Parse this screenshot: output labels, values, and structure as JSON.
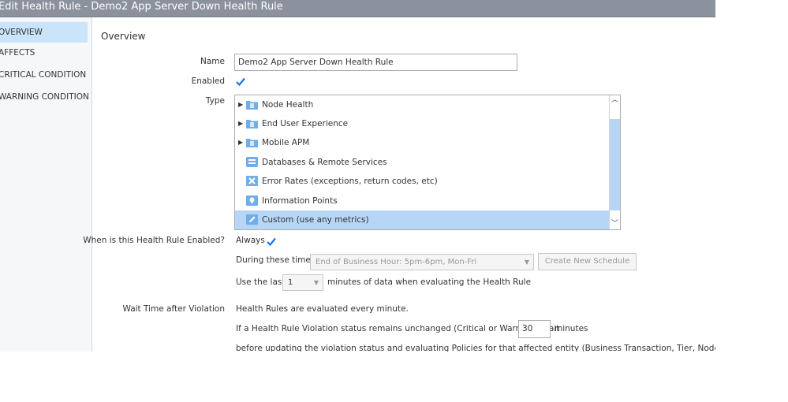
{
  "window": {
    "title": "Edit Health Rule - Demo2 App Server Down Health Rule"
  },
  "sidebar": {
    "items": [
      {
        "label": "OVERVIEW",
        "active": true
      },
      {
        "label": "AFFECTS",
        "active": false
      },
      {
        "label": "CRITICAL CONDITION",
        "active": false
      },
      {
        "label": "WARNING CONDITION",
        "active": false
      }
    ]
  },
  "overview": {
    "heading": "Overview",
    "name_label": "Name",
    "name_value": "Demo2 App Server Down Health Rule",
    "enabled_label": "Enabled",
    "enabled_checked": true,
    "type_label": "Type",
    "types": [
      {
        "label": "Node Health",
        "icon": "folder-icon",
        "expandable": true,
        "selected": false
      },
      {
        "label": "End User Experience",
        "icon": "folder-icon",
        "expandable": true,
        "selected": false
      },
      {
        "label": "Mobile APM",
        "icon": "folder-icon",
        "expandable": true,
        "selected": false
      },
      {
        "label": "Databases & Remote Services",
        "icon": "database-icon",
        "expandable": false,
        "selected": false
      },
      {
        "label": "Error Rates (exceptions, return codes, etc)",
        "icon": "error-x-icon",
        "expandable": false,
        "selected": false
      },
      {
        "label": "Information Points",
        "icon": "info-point-icon",
        "expandable": false,
        "selected": false
      },
      {
        "label": "Custom (use any metrics)",
        "icon": "pencil-icon",
        "expandable": false,
        "selected": true
      }
    ]
  },
  "schedule": {
    "when_label": "When is this Health Rule Enabled?",
    "always_label": "Always",
    "always_checked": true,
    "during_label": "During these times:",
    "during_value": "End of Business Hour: 5pm-6pm, Mon-Fri",
    "create_schedule_label": "Create New Schedule",
    "use_last_label": "Use the last",
    "use_last_value": "1",
    "minutes_label": "minutes of data when evaluating the Health Rule"
  },
  "wait": {
    "label": "Wait Time after Violation",
    "line1": "Health Rules are evaluated every minute.",
    "line2": "If a Health Rule Violation status remains unchanged (Critical or Warning), wait",
    "wait_value": "30",
    "minutes": "minutes",
    "line3": "before updating the violation status and evaluating Policies for that affected entity (Business Transaction, Tier, Node, etc)"
  },
  "colors": {
    "accent": "#1a73e8",
    "selection": "#b7d6f5",
    "titlebar": "#8c919e"
  }
}
